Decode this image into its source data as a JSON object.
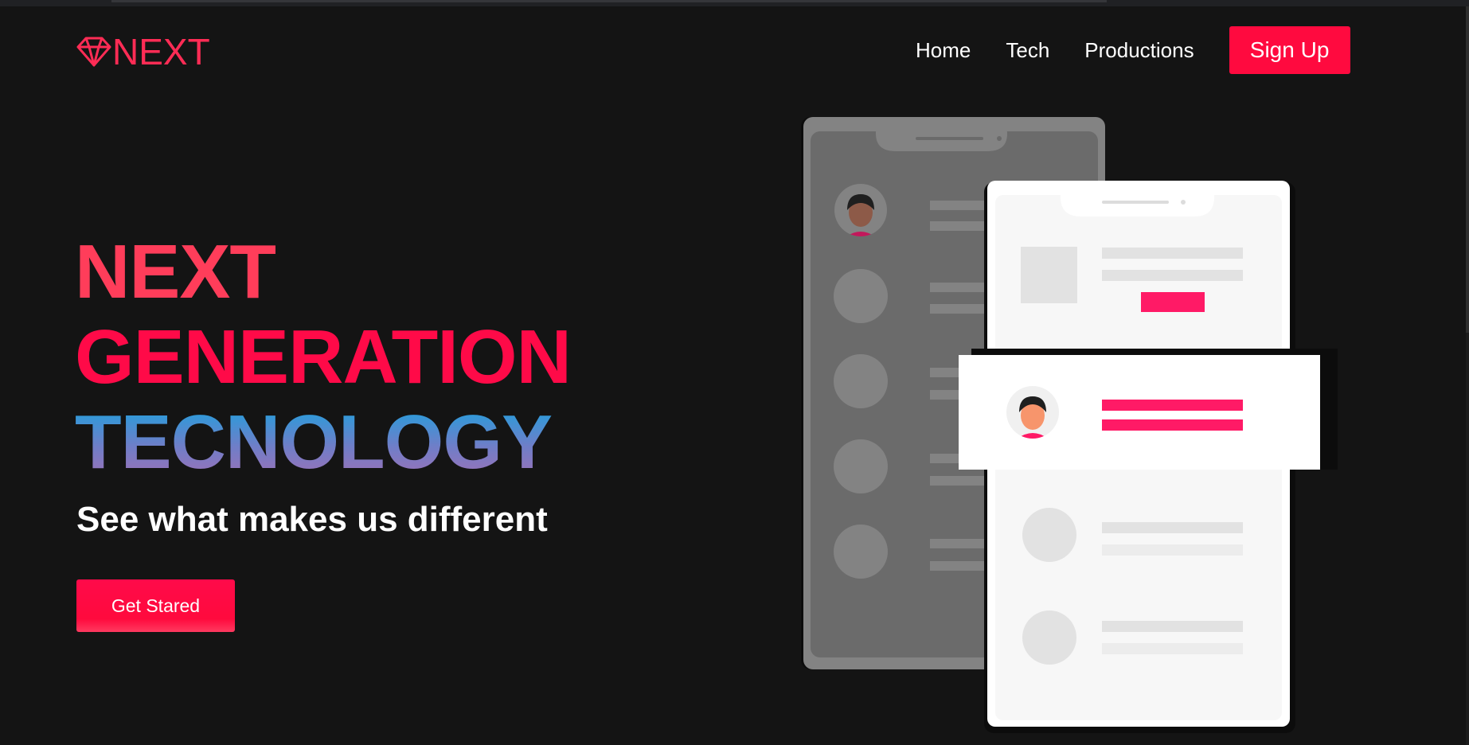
{
  "brand": {
    "name": "NEXT",
    "accent": "#ff0a3f",
    "logo_icon": "diamond-icon"
  },
  "nav": {
    "items": [
      {
        "label": "Home"
      },
      {
        "label": "Tech"
      },
      {
        "label": "Productions"
      }
    ],
    "signup_label": "Sign Up"
  },
  "hero": {
    "title_lines": [
      "NEXT",
      "GENERATION",
      "TECNOLOGY"
    ],
    "tagline": "See what makes us different",
    "cta_label": "Get Stared"
  },
  "colors": {
    "background": "#141414",
    "title_line1": "#ff3d5a",
    "title_line2": "#ff0a48",
    "title_line3_gradient": [
      "#15a5e0",
      "#a46fb4"
    ],
    "illustration_pink": "#ff1a66"
  }
}
